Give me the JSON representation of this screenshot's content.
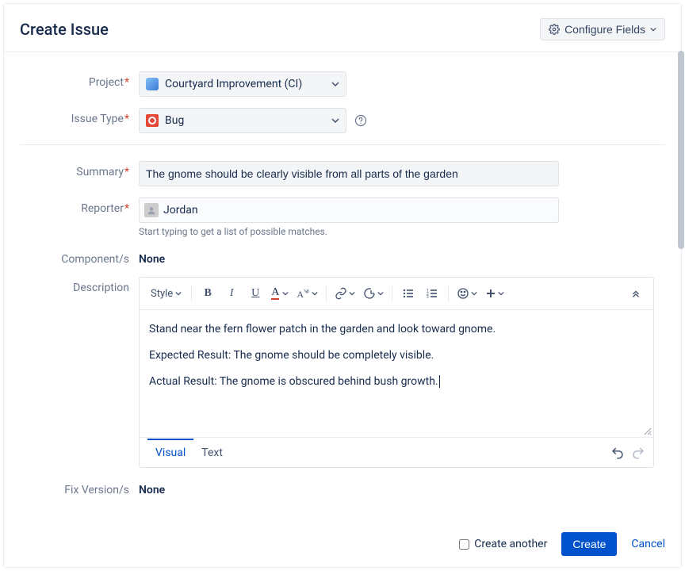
{
  "header": {
    "title": "Create Issue",
    "configure_label": "Configure Fields"
  },
  "labels": {
    "project": "Project",
    "issue_type": "Issue Type",
    "summary": "Summary",
    "reporter": "Reporter",
    "components": "Component/s",
    "description": "Description",
    "fix_versions": "Fix Version/s"
  },
  "fields": {
    "project": "Courtyard Improvement (CI)",
    "issue_type": "Bug",
    "summary": "The gnome should be clearly visible from all parts of the garden",
    "reporter": "Jordan",
    "reporter_hint": "Start typing to get a list of possible matches.",
    "components": "None",
    "fix_versions": "None"
  },
  "editor": {
    "toolbar": {
      "style_label": "Style"
    },
    "body": {
      "p1": "Stand near the fern flower patch in the garden and look toward gnome.",
      "p2": "Expected Result:  The gnome should be completely visible.",
      "p3": "Actual Result:  The gnome is obscured behind bush growth."
    },
    "tabs": {
      "visual": "Visual",
      "text": "Text"
    }
  },
  "footer": {
    "create_another": "Create another",
    "create": "Create",
    "cancel": "Cancel"
  }
}
